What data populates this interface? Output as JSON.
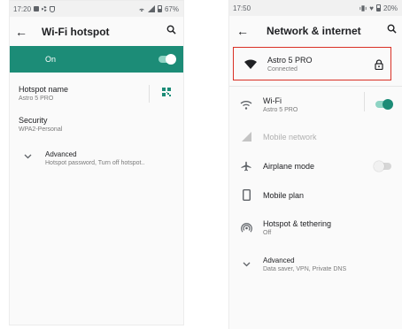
{
  "left": {
    "status": {
      "time": "17:20",
      "battery": "67%"
    },
    "title": "Wi-Fi hotspot",
    "switch_label": "On",
    "items": [
      {
        "title": "Hotspot name",
        "subtitle": "Astro 5 PRO"
      },
      {
        "title": "Security",
        "subtitle": "WPA2-Personal"
      }
    ],
    "advanced": {
      "title": "Advanced",
      "subtitle": "Hotspot password, Turn off hotspot.."
    }
  },
  "right": {
    "status": {
      "time": "17:50",
      "battery": "20%"
    },
    "title": "Network & internet",
    "banner": {
      "title": "Astro 5 PRO",
      "subtitle": "Connected"
    },
    "rows": {
      "wifi": {
        "title": "Wi-Fi",
        "subtitle": "Astro 5 PRO"
      },
      "mobile": {
        "title": "Mobile network"
      },
      "airplane": {
        "title": "Airplane mode"
      },
      "plan": {
        "title": "Mobile plan"
      },
      "hotspot": {
        "title": "Hotspot & tethering",
        "subtitle": "Off"
      }
    },
    "advanced": {
      "title": "Advanced",
      "subtitle": "Data saver, VPN, Private DNS"
    }
  },
  "colors": {
    "accent": "#1c8c77",
    "highlight": "#d93025",
    "icon": "#5f6368"
  },
  "icons": [
    "back-arrow-icon",
    "search-icon",
    "qr-code-icon",
    "chevron-down-icon",
    "wifi-icon",
    "signal-icon",
    "airplane-icon",
    "phone-icon",
    "hotspot-icon",
    "lock-icon",
    "battery-icon"
  ]
}
